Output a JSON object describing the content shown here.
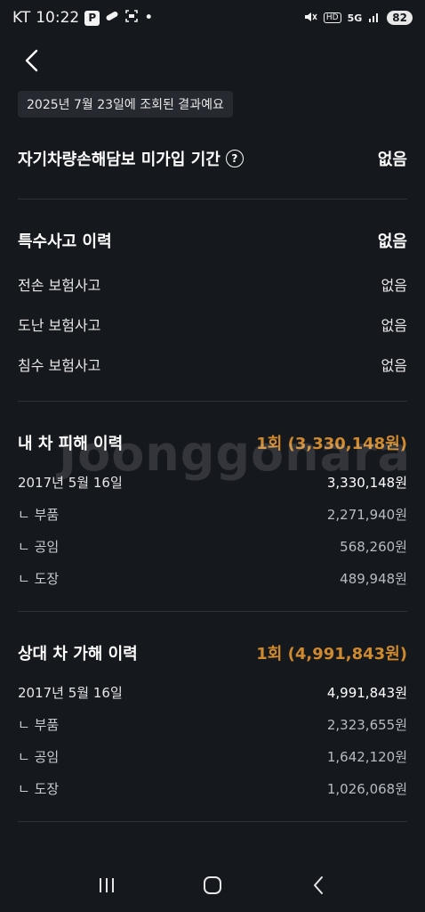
{
  "status_bar": {
    "carrier": "KT",
    "time": "10:22",
    "p_badge": "P",
    "dot": "•",
    "signal_label": "HD",
    "network": "5G",
    "battery": "82",
    "icons": [
      "parking-icon",
      "pill-icon",
      "screenshot-icon",
      "mute-icon",
      "hd-icon",
      "5g-icon",
      "signal-icon",
      "battery-icon"
    ]
  },
  "header": {
    "back_icon": "back-arrow-icon",
    "query_date": "2025년 7월 23일에 조회된 결과예요"
  },
  "uninsured": {
    "label": "자기차량손해담보 미가입 기간",
    "help_icon": "?",
    "value": "없음"
  },
  "special_accidents": {
    "title": "특수사고 이력",
    "value": "없음",
    "items": [
      {
        "label": "전손 보험사고",
        "value": "없음"
      },
      {
        "label": "도난 보험사고",
        "value": "없음"
      },
      {
        "label": "침수 보험사고",
        "value": "없음"
      }
    ]
  },
  "my_damage": {
    "title": "내 차 피해 이력",
    "summary": "1회 (3,330,148원)",
    "date": "2017년 5월 16일",
    "total": "3,330,148원",
    "items": [
      {
        "label": "ㄴ 부품",
        "value": "2,271,940원"
      },
      {
        "label": "ㄴ 공임",
        "value": "568,260원"
      },
      {
        "label": "ㄴ 도장",
        "value": "489,948원"
      }
    ]
  },
  "other_damage": {
    "title": "상대 차 가해 이력",
    "summary": "1회 (4,991,843원)",
    "date": "2017년 5월 16일",
    "total": "4,991,843원",
    "items": [
      {
        "label": "ㄴ 부품",
        "value": "2,323,655원"
      },
      {
        "label": "ㄴ 공임",
        "value": "1,642,120원"
      },
      {
        "label": "ㄴ 도장",
        "value": "1,026,068원"
      }
    ]
  },
  "watermark": "Joonggonara",
  "colors": {
    "background": "#15181d",
    "accent": "#d08a2e",
    "chip": "#262a30"
  },
  "nav": {
    "recents": "recents-icon",
    "home": "home-icon",
    "back": "back-icon"
  }
}
